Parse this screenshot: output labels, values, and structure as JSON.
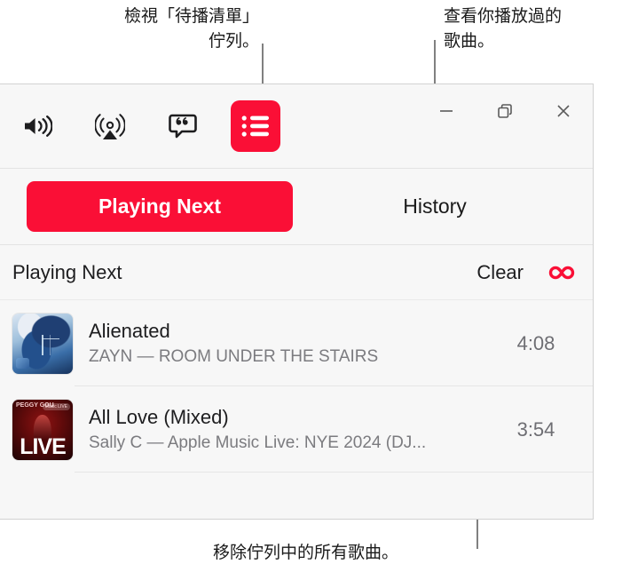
{
  "callouts": {
    "queue": "檢視「待播清單」\n佇列。",
    "history": "查看你播放過的\n歌曲。",
    "clear": "移除佇列中的所有歌曲。"
  },
  "toolbar": {
    "volume_label": "volume",
    "airplay_label": "airplay",
    "lyrics_label": "lyrics",
    "queue_label": "queue"
  },
  "window_controls": {
    "minimize_label": "minimize",
    "restore_label": "restore",
    "close_label": "close"
  },
  "tabs": [
    {
      "label": "Playing Next",
      "selected": true
    },
    {
      "label": "History",
      "selected": false
    }
  ],
  "queue_header": {
    "title": "Playing Next",
    "clear_label": "Clear",
    "infinity_label": "∞"
  },
  "tracks": [
    {
      "title": "Alienated",
      "subtitle": "ZAYN — ROOM UNDER THE STAIRS",
      "duration": "4:08",
      "artwork": "alienated-artwork"
    },
    {
      "title": "All Love (Mixed)",
      "subtitle": "Sally C — Apple Music Live: NYE 2024 (DJ...",
      "duration": "3:54",
      "artwork": "live-artwork",
      "artwork_text": {
        "peggy": "PEGGY\nGOU",
        "badge": "Music LIVE",
        "live": "LIVE"
      }
    }
  ],
  "colors": {
    "accent_red": "#fa0f36",
    "window_bg": "#f7f7f7",
    "text_primary": "#1d1d1f",
    "text_secondary": "#7b7b7f"
  }
}
